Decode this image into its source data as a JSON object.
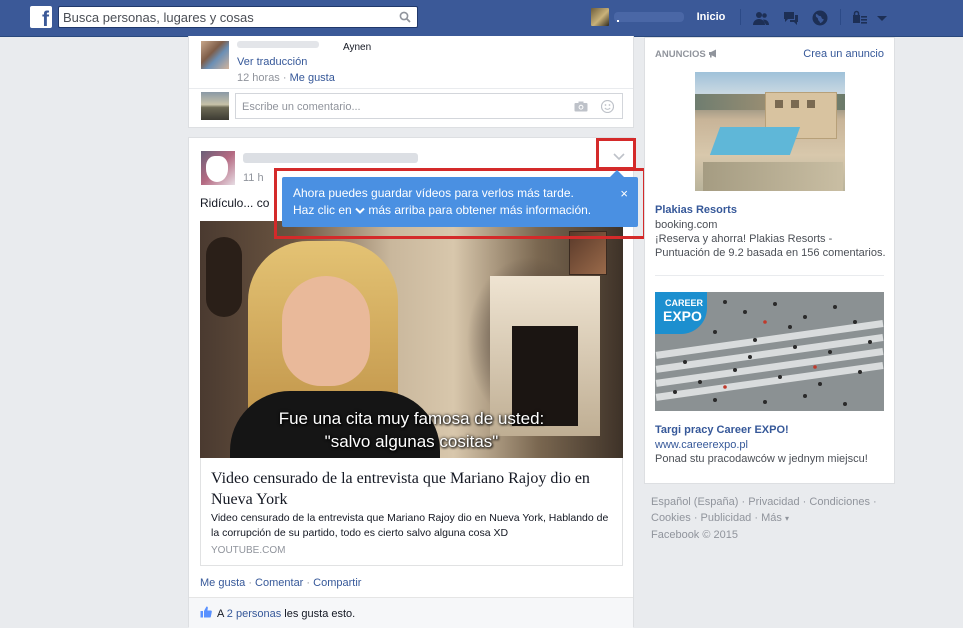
{
  "topbar": {
    "logo": "f",
    "search_placeholder": "Busca personas, lugares y cosas",
    "home_label": "Inicio"
  },
  "feed": {
    "post1": {
      "comment_author_suffix": "Aynen",
      "translate_link": "Ver traducción",
      "timestamp": "12 horas",
      "like_link": "Me gusta",
      "comment_placeholder": "Escribe un comentario..."
    },
    "post2": {
      "time_prefix": "11 h",
      "text_start": "Ridículo... co",
      "tooltip": {
        "line1": "Ahora puedes guardar vídeos para verlos más tarde.",
        "line2_a": "Haz clic en",
        "line2_b": "más arriba para obtener más información.",
        "close": "×"
      },
      "video": {
        "subtitle1": "Fue una cita muy famosa de usted:",
        "subtitle2": "\"salvo algunas cositas\""
      },
      "link": {
        "title": "Video censurado de la entrevista que Mariano Rajoy dio en Nueva York",
        "description": "Video censurado de la entrevista que Mariano Rajoy dio en Nueva York, Hablando de la corrupción de su partido, todo es cierto salvo alguna cosa XD",
        "source": "YOUTUBE.COM"
      },
      "actions": {
        "like": "Me gusta",
        "comment": "Comentar",
        "share": "Compartir",
        "sep": "·"
      },
      "likes": {
        "prefix": "A",
        "people_link": "2 personas",
        "suffix": "les gusta esto."
      }
    }
  },
  "sidebar": {
    "ads_label": "ANUNCIOS",
    "create_ad": "Crea un anuncio",
    "ads": [
      {
        "title": "Plakias Resorts",
        "domain": "booking.com",
        "text1": "¡Reserva y ahorra! Plakias Resorts -",
        "text2": "Puntuación de 9.2 basada en 156 comentarios."
      },
      {
        "badge1": "CAREER",
        "badge2": "EXPO",
        "title": "Targi pracy Career EXPO!",
        "domain": "www.careerexpo.pl",
        "text1": "Ponad stu pracodawców w jednym miejscu!"
      }
    ],
    "footer": {
      "lang": "Español (España)",
      "privacy": "Privacidad",
      "conditions": "Condiciones",
      "cookies": "Cookies",
      "ads": "Publicidad",
      "more": "Más",
      "copyright": "Facebook © 2015",
      "sep": "·"
    }
  }
}
